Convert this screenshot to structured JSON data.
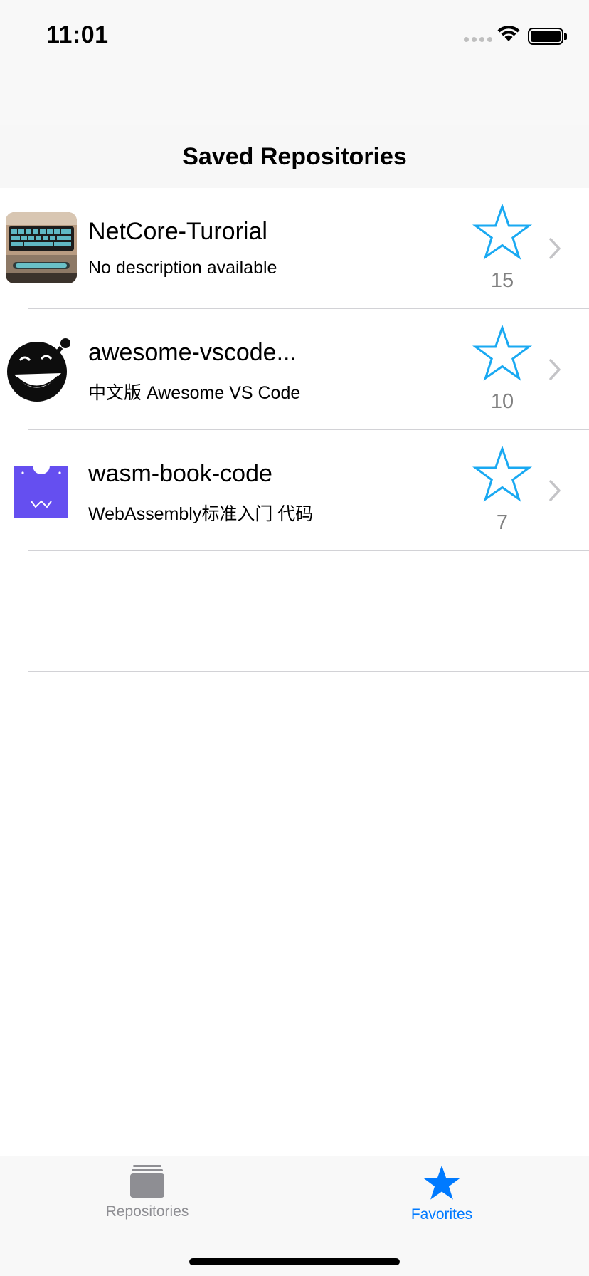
{
  "status_bar": {
    "time": "11:01"
  },
  "header": {
    "title": "Saved Repositories"
  },
  "repositories": [
    {
      "name": "NetCore-Turorial",
      "description": "No description available",
      "stars": "15",
      "avatar": "keyboard-photo"
    },
    {
      "name": "awesome-vscode...",
      "description": "中文版 Awesome VS Code",
      "stars": "10",
      "avatar": "black-smiley"
    },
    {
      "name": "wasm-book-code",
      "description": "WebAssembly标准入门 代码",
      "stars": "7",
      "avatar": "webassembly-logo"
    }
  ],
  "tab_bar": {
    "tabs": [
      {
        "label": "Repositories",
        "icon": "stack-icon",
        "selected": false
      },
      {
        "label": "Favorites",
        "icon": "star-icon",
        "selected": true
      }
    ]
  },
  "colors": {
    "accent": "#007aff",
    "star": "#19a9f2",
    "inactive": "#8e8e93"
  }
}
